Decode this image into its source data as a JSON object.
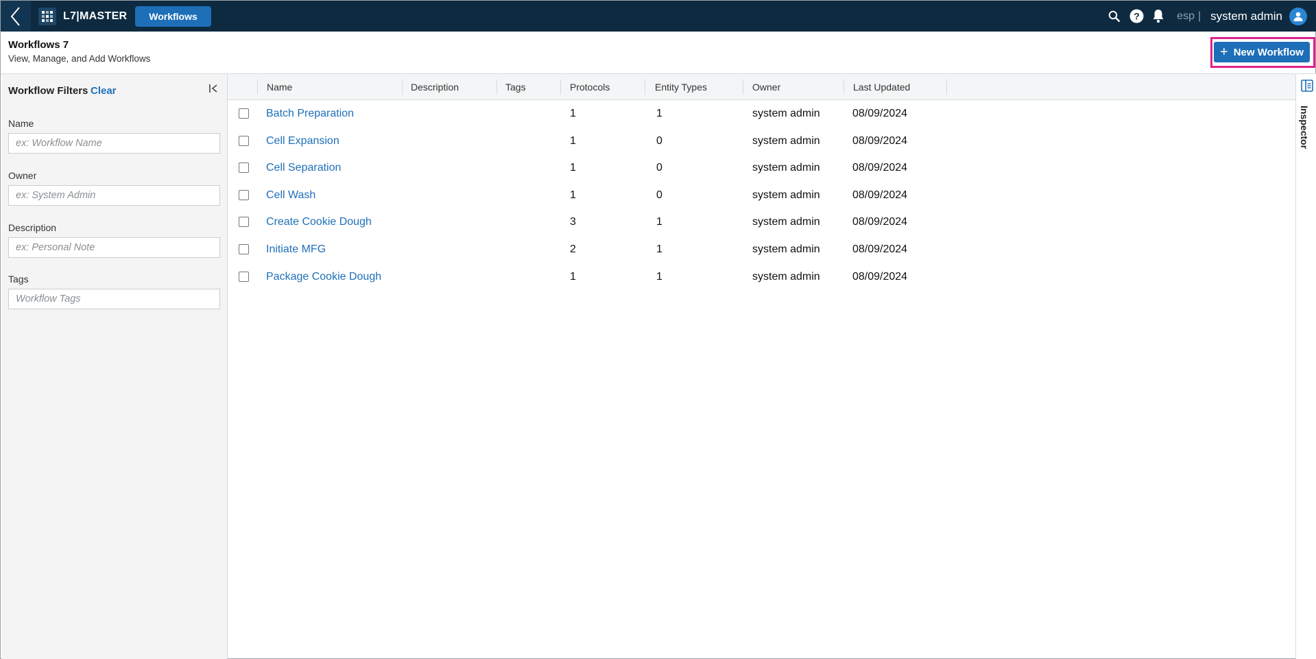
{
  "topbar": {
    "logo_text": "L7|MASTER",
    "active_app_tab": "Workflows",
    "language": "esp",
    "language_separator": "|",
    "user_name": "system admin"
  },
  "page": {
    "title": "Workflows 7",
    "subtitle": "View, Manage, and Add Workflows",
    "new_button_label": "New Workflow",
    "new_button_plus": "+"
  },
  "filters": {
    "title": "Workflow Filters",
    "clear_label": "Clear",
    "fields": [
      {
        "label": "Name",
        "placeholder": "ex: Workflow Name"
      },
      {
        "label": "Owner",
        "placeholder": "ex: System Admin"
      },
      {
        "label": "Description",
        "placeholder": "ex: Personal Note"
      },
      {
        "label": "Tags",
        "placeholder": "Workflow Tags"
      }
    ]
  },
  "table": {
    "columns": [
      "Name",
      "Description",
      "Tags",
      "Protocols",
      "Entity Types",
      "Owner",
      "Last Updated"
    ],
    "rows": [
      {
        "name": "Batch Preparation",
        "description": "",
        "tags": "",
        "protocols": "1",
        "entity_types": "1",
        "owner": "system admin",
        "last_updated": "08/09/2024"
      },
      {
        "name": "Cell Expansion",
        "description": "",
        "tags": "",
        "protocols": "1",
        "entity_types": "0",
        "owner": "system admin",
        "last_updated": "08/09/2024"
      },
      {
        "name": "Cell Separation",
        "description": "",
        "tags": "",
        "protocols": "1",
        "entity_types": "0",
        "owner": "system admin",
        "last_updated": "08/09/2024"
      },
      {
        "name": "Cell Wash",
        "description": "",
        "tags": "",
        "protocols": "1",
        "entity_types": "0",
        "owner": "system admin",
        "last_updated": "08/09/2024"
      },
      {
        "name": "Create Cookie Dough",
        "description": "",
        "tags": "",
        "protocols": "3",
        "entity_types": "1",
        "owner": "system admin",
        "last_updated": "08/09/2024"
      },
      {
        "name": "Initiate MFG",
        "description": "",
        "tags": "",
        "protocols": "2",
        "entity_types": "1",
        "owner": "system admin",
        "last_updated": "08/09/2024"
      },
      {
        "name": "Package Cookie Dough",
        "description": "",
        "tags": "",
        "protocols": "1",
        "entity_types": "1",
        "owner": "system admin",
        "last_updated": "08/09/2024"
      }
    ]
  },
  "inspector": {
    "label": "Inspector"
  },
  "colors": {
    "topbar_bg": "#0d2a40",
    "accent": "#1d6fb8",
    "highlight": "#e0218a"
  },
  "icons": [
    "back-chevron-icon",
    "app-logo-icon",
    "search-icon",
    "help-icon",
    "bell-icon",
    "user-avatar-icon",
    "collapse-panel-icon",
    "inspector-panel-icon"
  ]
}
